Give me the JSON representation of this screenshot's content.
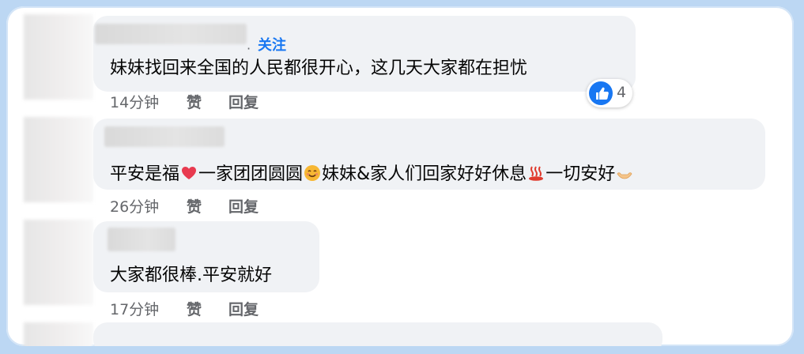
{
  "comments": [
    {
      "follow_label": "关注",
      "follow_dot": "·",
      "text": "妹妹找回来全国的人民都很开心，这几天大家都在担忧",
      "time": "14分钟",
      "like_label": "赞",
      "reply_label": "回复",
      "reaction_count": "4",
      "reaction_icon": "thumbs-up-icon"
    },
    {
      "text_parts": [
        "平安是福",
        "一家团团圆圆",
        "妹妹&家人们回家好好休息",
        "一切安好"
      ],
      "emojis": [
        "heart-icon",
        "smiling-face-icon",
        "hot-springs-icon",
        "palms-up-icon"
      ],
      "time": "26分钟",
      "like_label": "赞",
      "reply_label": "回复"
    },
    {
      "text": "大家都很棒.平安就好",
      "time": "17分钟",
      "like_label": "赞",
      "reply_label": "回复"
    }
  ],
  "colors": {
    "follow": "#1877f2",
    "bubble": "#f0f2f5",
    "meta": "#65676b",
    "frame_border": "#bcd7f3"
  }
}
